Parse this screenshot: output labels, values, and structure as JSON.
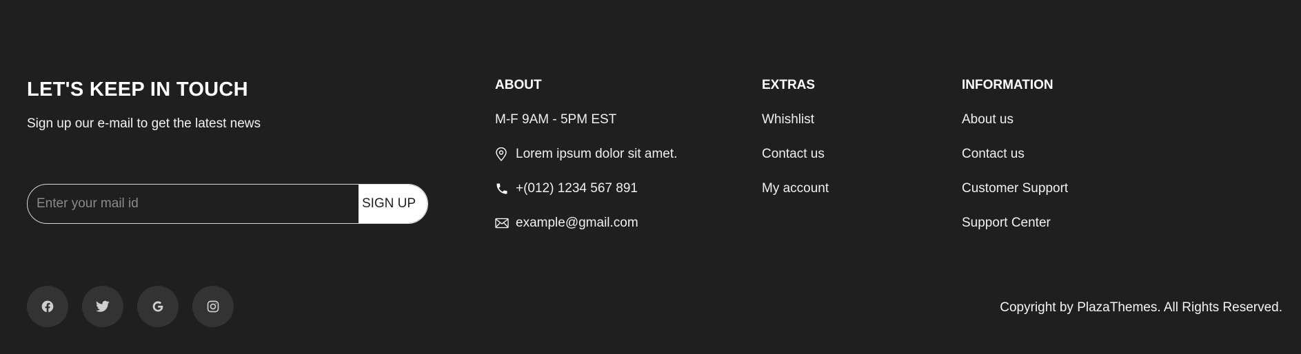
{
  "newsletter": {
    "title": "LET'S KEEP IN TOUCH",
    "subtitle": "Sign up our e-mail to get the latest news",
    "input_placeholder": "Enter your mail id",
    "button_label": "SIGN UP"
  },
  "about": {
    "title": "ABOUT",
    "hours": "M-F 9AM - 5PM EST",
    "address": "Lorem ipsum dolor sit amet.",
    "phone": "+(012) 1234 567 891",
    "email": "example@gmail.com",
    "icons": [
      "location-pin-icon",
      "phone-icon",
      "envelope-icon"
    ]
  },
  "extras": {
    "title": "EXTRAS",
    "items": [
      "Whishlist",
      "Contact us",
      "My account"
    ]
  },
  "information": {
    "title": "INFORMATION",
    "items": [
      "About us",
      "Contact us",
      "Customer Support",
      "Support Center"
    ]
  },
  "social": {
    "icons": [
      "facebook-icon",
      "twitter-icon",
      "google-icon",
      "instagram-icon"
    ]
  },
  "copyright": "Copyright by PlazaThemes. All Rights Reserved.",
  "colors": {
    "background": "#1f1f1f",
    "text": "#ffffff",
    "social_bg": "#333333",
    "button_bg": "#ffffff"
  }
}
